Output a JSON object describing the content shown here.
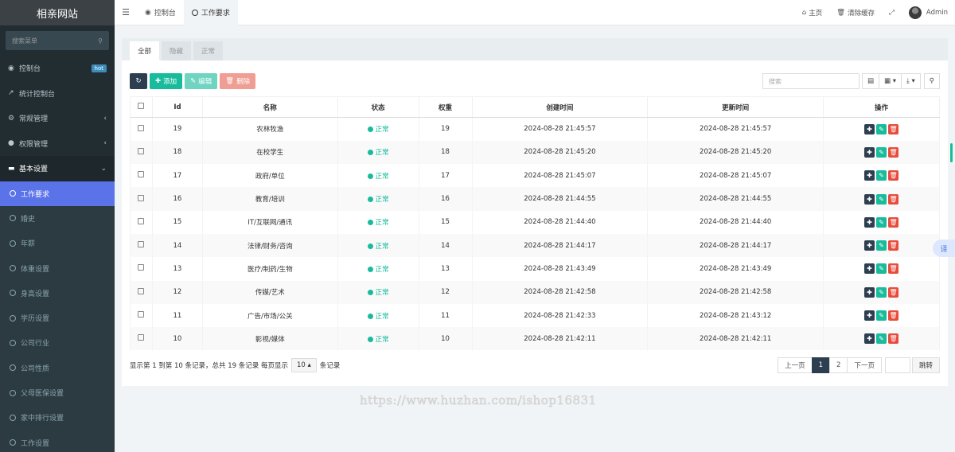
{
  "sidebar": {
    "logo": "相亲网站",
    "search_placeholder": "搜索菜单",
    "items": [
      {
        "label": "控制台",
        "badge": "hot"
      },
      {
        "label": "统计控制台"
      },
      {
        "label": "常规管理"
      },
      {
        "label": "权限管理"
      },
      {
        "label": "基本设置"
      }
    ],
    "subitems": [
      "工作要求",
      "婚史",
      "年薪",
      "体重设置",
      "身高设置",
      "学历设置",
      "公司行业",
      "公司性质",
      "父母医保设置",
      "家中排行设置",
      "工作设置"
    ]
  },
  "topbar": {
    "tabs": [
      "控制台",
      "工作要求"
    ],
    "home": "主页",
    "clear_cache": "清除缓存",
    "user": "Admin"
  },
  "panel": {
    "tabs": [
      "全部",
      "隐藏",
      "正常"
    ],
    "buttons": {
      "add": "添加",
      "edit": "编辑",
      "delete": "删除"
    },
    "search_placeholder": "搜索"
  },
  "table": {
    "headers": [
      "Id",
      "名称",
      "状态",
      "权重",
      "创建时间",
      "更新时间",
      "操作"
    ],
    "rows": [
      {
        "id": "19",
        "name": "农林牧渔",
        "status": "正常",
        "weight": "19",
        "created": "2024-08-28 21:45:57",
        "updated": "2024-08-28 21:45:57"
      },
      {
        "id": "18",
        "name": "在校学生",
        "status": "正常",
        "weight": "18",
        "created": "2024-08-28 21:45:20",
        "updated": "2024-08-28 21:45:20"
      },
      {
        "id": "17",
        "name": "政府/单位",
        "status": "正常",
        "weight": "17",
        "created": "2024-08-28 21:45:07",
        "updated": "2024-08-28 21:45:07"
      },
      {
        "id": "16",
        "name": "教育/培训",
        "status": "正常",
        "weight": "16",
        "created": "2024-08-28 21:44:55",
        "updated": "2024-08-28 21:44:55"
      },
      {
        "id": "15",
        "name": "IT/互联网/通讯",
        "status": "正常",
        "weight": "15",
        "created": "2024-08-28 21:44:40",
        "updated": "2024-08-28 21:44:40"
      },
      {
        "id": "14",
        "name": "法律/财务/咨询",
        "status": "正常",
        "weight": "14",
        "created": "2024-08-28 21:44:17",
        "updated": "2024-08-28 21:44:17"
      },
      {
        "id": "13",
        "name": "医疗/制药/生物",
        "status": "正常",
        "weight": "13",
        "created": "2024-08-28 21:43:49",
        "updated": "2024-08-28 21:43:49"
      },
      {
        "id": "12",
        "name": "传媒/艺术",
        "status": "正常",
        "weight": "12",
        "created": "2024-08-28 21:42:58",
        "updated": "2024-08-28 21:42:58"
      },
      {
        "id": "11",
        "name": "广告/市场/公关",
        "status": "正常",
        "weight": "11",
        "created": "2024-08-28 21:42:33",
        "updated": "2024-08-28 21:43:12"
      },
      {
        "id": "10",
        "name": "影视/媒体",
        "status": "正常",
        "weight": "10",
        "created": "2024-08-28 21:42:11",
        "updated": "2024-08-28 21:42:11"
      }
    ]
  },
  "footer": {
    "summary": "显示第 1 到第 10 条记录，总共 19 条记录 每页显示",
    "page_size": "10",
    "summary_suffix": "条记录",
    "prev": "上一页",
    "pages": [
      "1",
      "2"
    ],
    "next": "下一页",
    "jump": "跳转"
  },
  "watermark": "https://www.huzhan.com/ishop16831",
  "translate": "译",
  "colors": {
    "sidebar": "#222d32",
    "active": "#5b73e8",
    "success": "#18bc9c",
    "danger": "#e74c3c",
    "dark": "#2c3e50"
  }
}
